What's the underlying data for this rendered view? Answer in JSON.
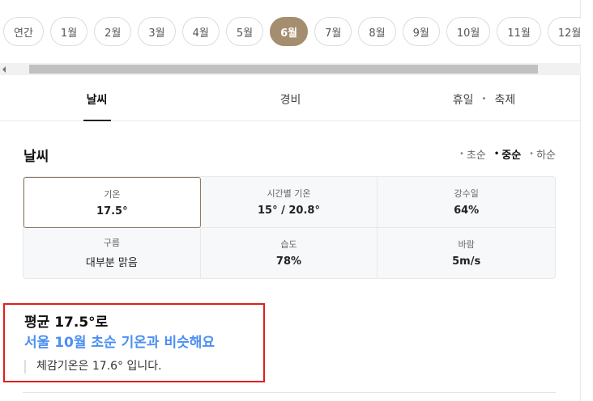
{
  "months": {
    "items": [
      "연간",
      "1월",
      "2월",
      "3월",
      "4월",
      "5월",
      "6월",
      "7월",
      "8월",
      "9월",
      "10월",
      "11월",
      "12월"
    ],
    "selected": "6월"
  },
  "tabs": {
    "weather": "날씨",
    "cost": "경비",
    "holiday": "휴일",
    "festival": "축제",
    "separator": "•"
  },
  "weather": {
    "title": "날씨",
    "periods": [
      "초순",
      "중순",
      "하순"
    ],
    "selected_period": "중순",
    "bullet": "•",
    "stats": [
      {
        "label": "기온",
        "value": "17.5°"
      },
      {
        "label": "시간별 기온",
        "value": "15° / 20.8°"
      },
      {
        "label": "강수일",
        "value": "64%"
      },
      {
        "label": "구름",
        "value": "대부분 맑음"
      },
      {
        "label": "습도",
        "value": "78%"
      },
      {
        "label": "바람",
        "value": "5m/s"
      }
    ]
  },
  "summary": {
    "average": "평균 17.5°로",
    "headline": "서울 10월 초순 기온과 비슷해요",
    "feels_like": "체감기온은 17.6° 입니다."
  },
  "colors": {
    "accent": "#a58d6f",
    "highlight_text": "#4b8ff2",
    "annotation_border": "#e01e1e"
  }
}
